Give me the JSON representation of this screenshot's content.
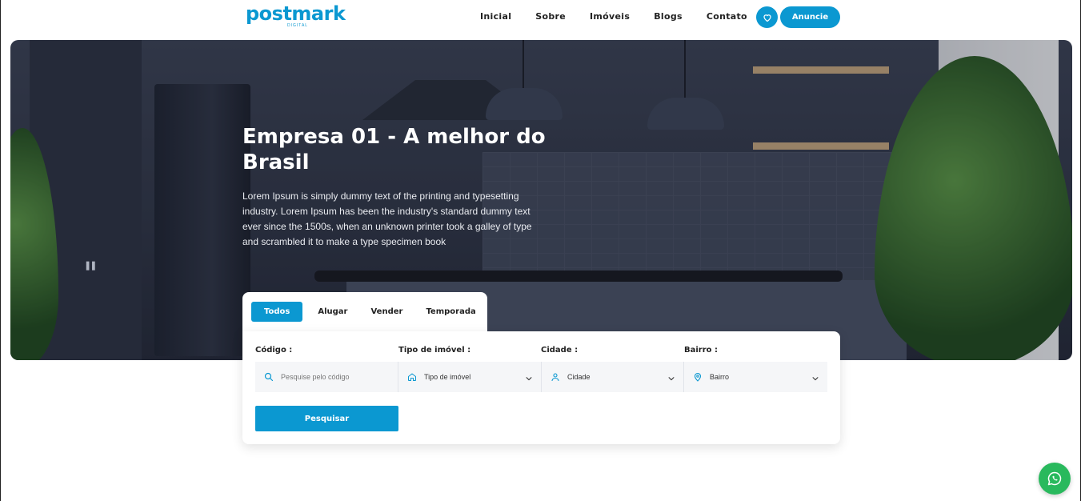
{
  "header": {
    "logo_text": "postmark",
    "logo_sub": "DIGITAL",
    "nav": [
      "Inicial",
      "Sobre",
      "Imóveis",
      "Blogs",
      "Contato"
    ],
    "favorite_icon": "heart-icon",
    "cta_label": "Anuncie"
  },
  "hero": {
    "title": "Empresa 01 - A melhor do Brasil",
    "text": "Lorem Ipsum is simply dummy text of the printing and typesetting industry. Lorem Ipsum has been the industry's standard dummy text ever since the 1500s, when an unknown printer took a galley of type and scrambled it to make a type specimen book",
    "pause_icon": "pause-icon"
  },
  "search": {
    "tabs": [
      "Todos",
      "Alugar",
      "Vender",
      "Temporada"
    ],
    "active_tab": "Todos",
    "fields": {
      "code_label": "Código :",
      "code_placeholder": "Pesquise pelo código",
      "type_label": "Tipo de imóvel :",
      "type_value": "Tipo de imóvel",
      "city_label": "Cidade :",
      "city_value": "Cidade",
      "district_label": "Bairro :",
      "district_value": "Bairro"
    },
    "submit_label": "Pesquisar"
  },
  "floating": {
    "whatsapp_icon": "whatsapp-icon"
  },
  "colors": {
    "accent": "#0b98d1",
    "whatsapp": "#29b95d"
  }
}
